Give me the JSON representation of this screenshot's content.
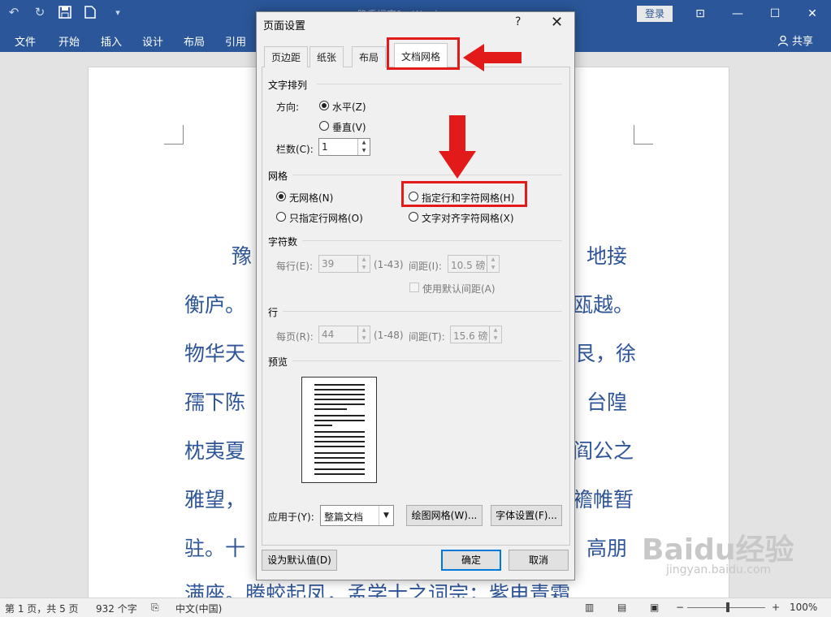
{
  "window": {
    "title": "隐手福字1 - Word",
    "login_label": "登录",
    "share_label": "共享"
  },
  "ribbon_tabs": [
    "文件",
    "开始",
    "插入",
    "设计",
    "布局",
    "引用"
  ],
  "document": {
    "lines": [
      {
        "left": "豫",
        "right": "地接"
      },
      {
        "left": "衡庐。",
        "right": "瓯越。"
      },
      {
        "left": "物华天",
        "right": "艮，徐"
      },
      {
        "left": "孺下陈",
        "right": "台隍"
      },
      {
        "left": "枕夷夏",
        "right": "阎公之"
      },
      {
        "left": "雅望，",
        "right": "襜帷暂"
      },
      {
        "left": "驻。十",
        "right": "高朋"
      },
      {
        "left": "满座。腾蛟起凤，孟学士之词宗；紫电青霜",
        "right": ""
      }
    ]
  },
  "dialog": {
    "title": "页面设置",
    "help": "?",
    "close": "✕",
    "tabs": [
      "页边距",
      "纸张",
      "布局",
      "文档网格"
    ],
    "active_tab": "文档网格",
    "text_direction": {
      "section_title": "文字排列",
      "direction_label": "方向:",
      "horizontal": "水平(Z)",
      "vertical": "垂直(V)",
      "selected": "水平(Z)",
      "columns_label": "栏数(C):",
      "columns_value": "1"
    },
    "grid": {
      "section_title": "网格",
      "options": [
        "无网格(N)",
        "指定行和字符网格(H)",
        "只指定行网格(O)",
        "文字对齐字符网格(X)"
      ],
      "selected": "无网格(N)"
    },
    "characters": {
      "section_title": "字符数",
      "per_line_label": "每行(E):",
      "per_line_value": "39",
      "per_line_range": "(1-43)",
      "pitch_label": "间距(I):",
      "pitch_value": "10.5 磅",
      "default_pitch_label": "使用默认间距(A)"
    },
    "lines": {
      "section_title": "行",
      "per_page_label": "每页(R):",
      "per_page_value": "44",
      "per_page_range": "(1-48)",
      "pitch_label": "间距(T):",
      "pitch_value": "15.6 磅"
    },
    "preview": {
      "section_title": "预览"
    },
    "apply_to_label": "应用于(Y):",
    "apply_to_value": "整篇文档",
    "draw_grid_button": "绘图网格(W)...",
    "font_settings_button": "字体设置(F)...",
    "set_default_button": "设为默认值(D)",
    "ok_button": "确定",
    "cancel_button": "取消"
  },
  "statusbar": {
    "page_info": "第 1 页，共 5 页",
    "word_count": "932 个字",
    "language": "中文(中国)",
    "zoom": "100%"
  },
  "watermark": {
    "main": "Baidu经验",
    "sub": "jingyan.baidu.com"
  },
  "colors": {
    "ribbon_blue": "#2b579a",
    "document_text": "#2e5597",
    "annotation_red": "#e21a1a"
  }
}
